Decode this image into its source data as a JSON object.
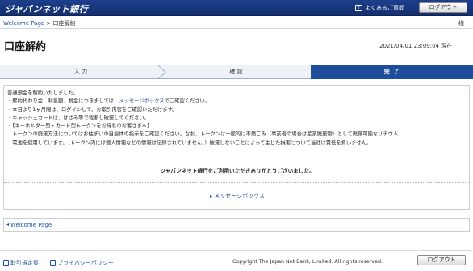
{
  "header": {
    "logo": "ジャパンネット銀行",
    "faq_label": "よくあるご質問",
    "logout_label": "ログアウト"
  },
  "breadcrumb": {
    "home": "Welcome Page",
    "separator": ">",
    "current": "口座解約"
  },
  "user": {
    "honorific": "様"
  },
  "page": {
    "title": "口座解約",
    "datetime": "2021/04/01 23:09:04 現在"
  },
  "steps": [
    {
      "label": "入 力",
      "active": false
    },
    {
      "label": "確 認",
      "active": false
    },
    {
      "label": "完 了",
      "active": true
    }
  ],
  "notice": {
    "lines": [
      "普通預金を解約いたしました。",
      "・解約代わり金、利息額、税金につきましては、",
      "・本日より1ヶ月間は、ログインして、お取引内容をご確認いただけます。",
      "・キャッシュカードは、はさみ等で裁断し破棄してください。",
      "・【キーホルダー型・カード型トークンをお持ちのお客さまへ】",
      "　トークンの廃棄方法についてはお住まいの自治体の指示をご確認ください。なお、トークンは一般的に不燃ごみ（事業者の場合は産業廃棄物）として廃棄可能なリチウム",
      "　電池を使用しています。（トークン内には個人情報などの情報は記録されていません。）破棄しないことによって生じた損害について当社は責任を負いません。"
    ],
    "line2_link": "メッセージボックス",
    "line2_suffix": "でご確認ください。",
    "thanks": "ジャパンネット銀行をご利用いただきありがとうございました。",
    "message_box_link": "メッセージボックス"
  },
  "back_link": "Welcome Page",
  "footer": {
    "links": [
      "取引規定集",
      "プライバシーポリシー"
    ],
    "copyright": "Copyright The Japan Net Bank, Limited. All rights reserved.",
    "logout_label": "ログアウト"
  },
  "colors": {
    "header_bg": "#1d3f8c",
    "active_step": "#1e4d9b",
    "link": "#1a4fa8"
  }
}
